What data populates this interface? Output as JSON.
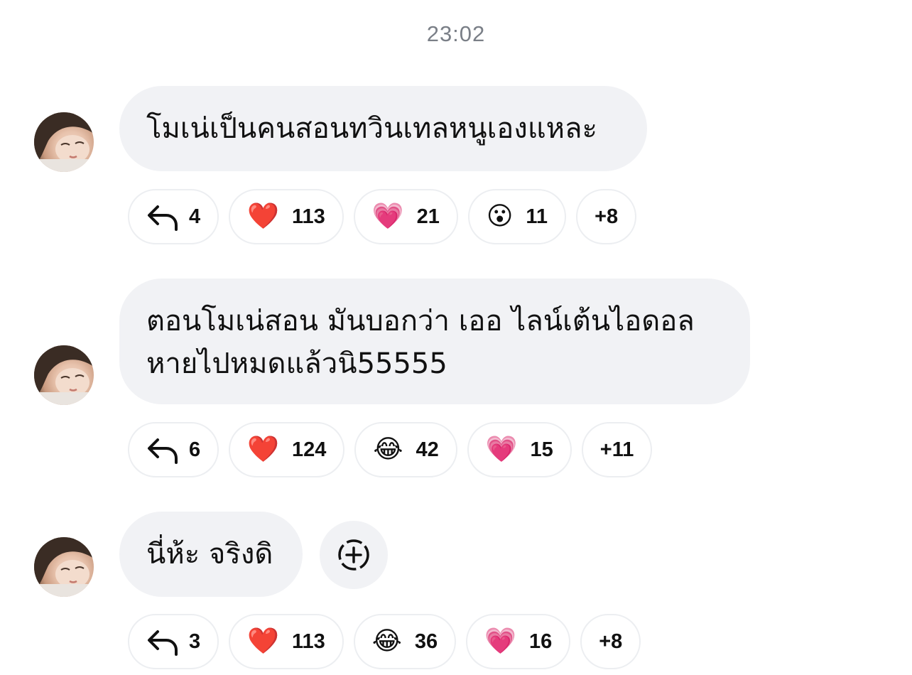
{
  "timestamp": "23:02",
  "messages": [
    {
      "text_lines": [
        "โมเน่เป็นคนสอนทวินเทลหนูเองแหละ"
      ],
      "reactions": {
        "reply_count": "4",
        "items": [
          {
            "emoji": "❤️",
            "icon": "red-heart-icon",
            "count": "113"
          },
          {
            "emoji": "💗",
            "icon": "growing-heart-icon",
            "count": "21"
          },
          {
            "emoji": "😮",
            "icon": "surprised-face-icon",
            "count": "11"
          }
        ],
        "more": "+8"
      }
    },
    {
      "text_lines": [
        "ตอนโมเน่สอน มันบอกว่า เออ ไลน์เต้นไอดอล",
        "หายไปหมดแล้วนิ55555"
      ],
      "reactions": {
        "reply_count": "6",
        "items": [
          {
            "emoji": "❤️",
            "icon": "red-heart-icon",
            "count": "124"
          },
          {
            "emoji": "😂",
            "icon": "tears-of-joy-icon",
            "count": "42"
          },
          {
            "emoji": "💗",
            "icon": "growing-heart-icon",
            "count": "15"
          }
        ],
        "more": "+11"
      }
    },
    {
      "text_lines": [
        "นี่ห้ะ จริงดิ"
      ],
      "reactions": {
        "reply_count": "3",
        "items": [
          {
            "emoji": "❤️",
            "icon": "red-heart-icon",
            "count": "113"
          },
          {
            "emoji": "😂",
            "icon": "tears-of-joy-icon",
            "count": "36"
          },
          {
            "emoji": "💗",
            "icon": "growing-heart-icon",
            "count": "16"
          }
        ],
        "more": "+8"
      }
    }
  ],
  "colors": {
    "bubble_bg": "#f1f2f5",
    "timestamp": "#7a7f87",
    "pill_border": "#eceef1"
  }
}
